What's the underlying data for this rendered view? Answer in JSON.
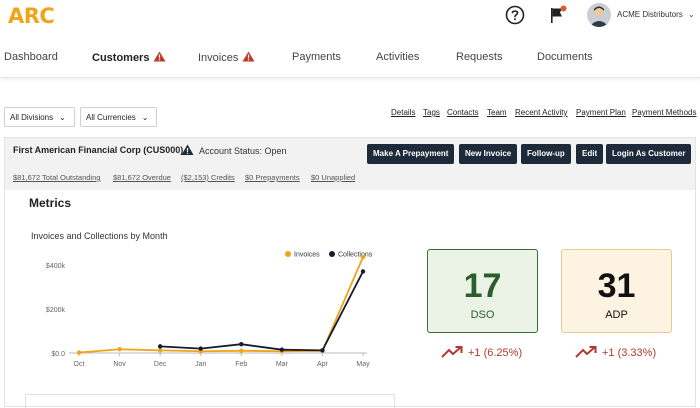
{
  "header": {
    "logo": "ARC",
    "account_name": "ACME Distributors",
    "colors": {
      "brand": "#f0a41b",
      "flag": "#e05a2b"
    }
  },
  "nav": {
    "items": [
      {
        "label": "Dashboard"
      },
      {
        "label": "Customers"
      },
      {
        "label": "Invoices"
      },
      {
        "label": "Payments"
      },
      {
        "label": "Activities"
      },
      {
        "label": "Requests"
      },
      {
        "label": "Documents"
      }
    ]
  },
  "filters": {
    "divisions": "All Divisions",
    "currencies": "All Currencies"
  },
  "links": [
    "Details",
    "Tags",
    "Contacts",
    "Team",
    "Recent Activity",
    "Payment Plan",
    "Payment Methods"
  ],
  "account": {
    "title": "First American Financial Corp (CUS000)",
    "status": "Account Status: Open",
    "buttons": [
      "Make A Prepayment",
      "New Invoice",
      "Follow-up",
      "Edit",
      "Login As Customer"
    ],
    "summary": [
      "$81,672 Total Outstanding",
      "$81,672 Overdue",
      "($2,153) Credits",
      "$0 Prepayments",
      "$0 Unapplied"
    ]
  },
  "metrics": {
    "title": "Metrics",
    "chart_title": "Invoices and Collections by Month",
    "dso": {
      "value": "17",
      "label": "DSO",
      "trend": "+1 (6.25%)"
    },
    "adp": {
      "value": "31",
      "label": "ADP",
      "trend": "+1 (3.33%)"
    }
  },
  "chart_data": {
    "type": "line",
    "categories": [
      "Oct",
      "Nov",
      "Dec",
      "Jan",
      "Feb",
      "Mar",
      "Apr",
      "May"
    ],
    "ytick_labels": [
      "$0.0",
      "$200k",
      "$400k"
    ],
    "ylim": [
      0,
      440000
    ],
    "grid": false,
    "legend_position": "top-right",
    "series": [
      {
        "name": "Invoices",
        "color": "#f0a41b",
        "values": [
          2000,
          17000,
          12000,
          8000,
          10000,
          8000,
          10000,
          435000
        ]
      },
      {
        "name": "Collections",
        "color": "#1a1a2e",
        "values": [
          null,
          null,
          30000,
          20000,
          40000,
          15000,
          12000,
          370000
        ]
      }
    ]
  }
}
